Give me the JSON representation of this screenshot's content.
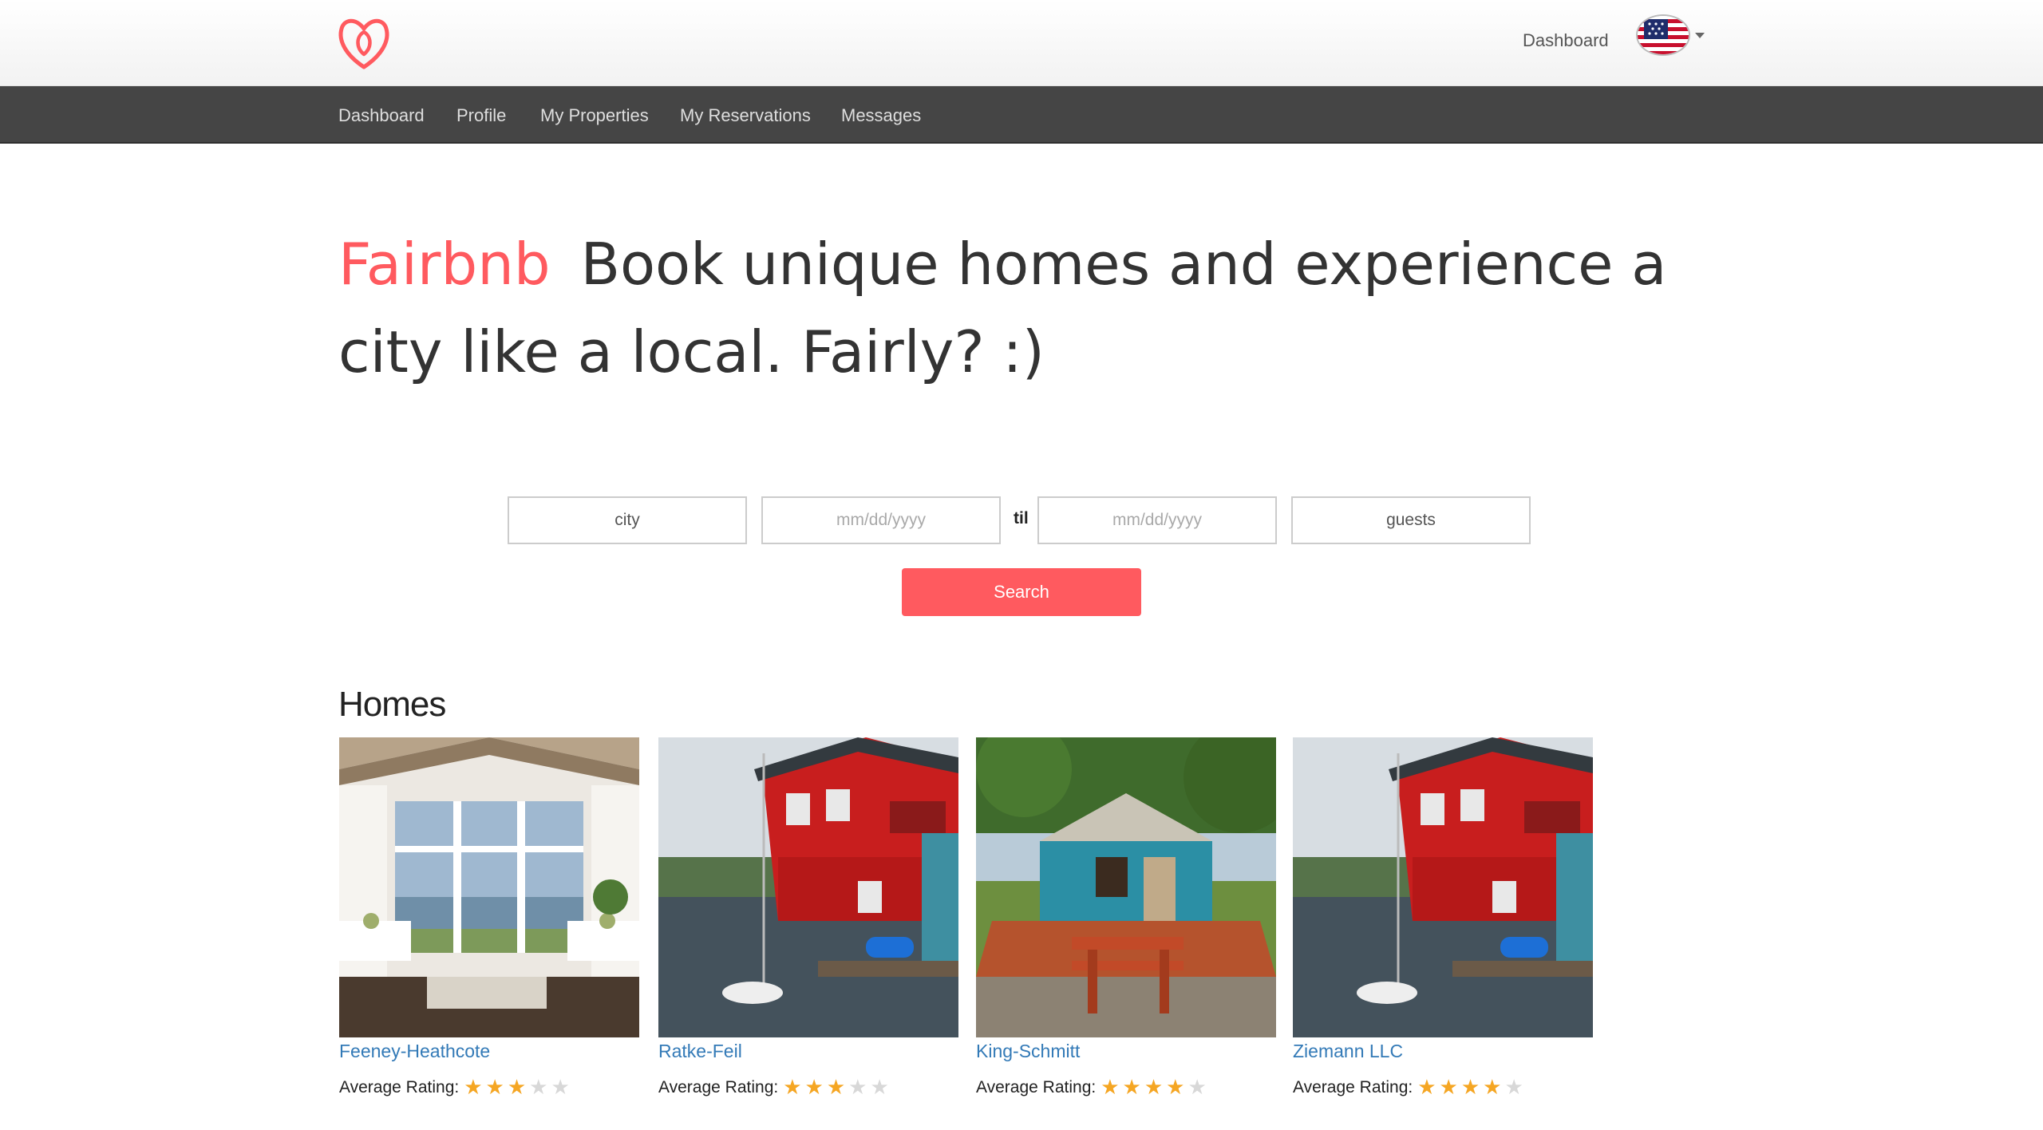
{
  "header": {
    "dashboard_link": "Dashboard",
    "logo_icon": "fairbnb-logo-icon",
    "language_flag_icon": "us-flag-icon"
  },
  "nav": {
    "items": [
      {
        "label": "Dashboard"
      },
      {
        "label": "Profile"
      },
      {
        "label": "My Properties"
      },
      {
        "label": "My Reservations"
      },
      {
        "label": "Messages"
      }
    ]
  },
  "hero": {
    "brand": "Fairbnb",
    "tagline": "Book unique homes and experience a city like a local. Fairly? :)"
  },
  "search": {
    "city_placeholder": "city",
    "checkin_placeholder": "mm/dd/yyyy",
    "between_label": "til",
    "checkout_placeholder": "mm/dd/yyyy",
    "guests_placeholder": "guests",
    "button_label": "Search"
  },
  "homes": {
    "title": "Homes",
    "rating_label": "Average Rating:",
    "items": [
      {
        "name": "Feeney-Heathcote",
        "rating": 3,
        "max_rating": 5,
        "image": "sunroom-interior"
      },
      {
        "name": "Ratke-Feil",
        "rating": 3,
        "max_rating": 5,
        "image": "red-houseboat"
      },
      {
        "name": "King-Schmitt",
        "rating": 4,
        "max_rating": 5,
        "image": "blue-yurt"
      },
      {
        "name": "Ziemann LLC",
        "rating": 4,
        "max_rating": 5,
        "image": "red-houseboat"
      }
    ]
  },
  "colors": {
    "brand": "#ff5a5f",
    "nav_bg": "#454545",
    "link": "#337ab7",
    "star_on": "#f5a623",
    "star_off": "#d8d8d8"
  }
}
